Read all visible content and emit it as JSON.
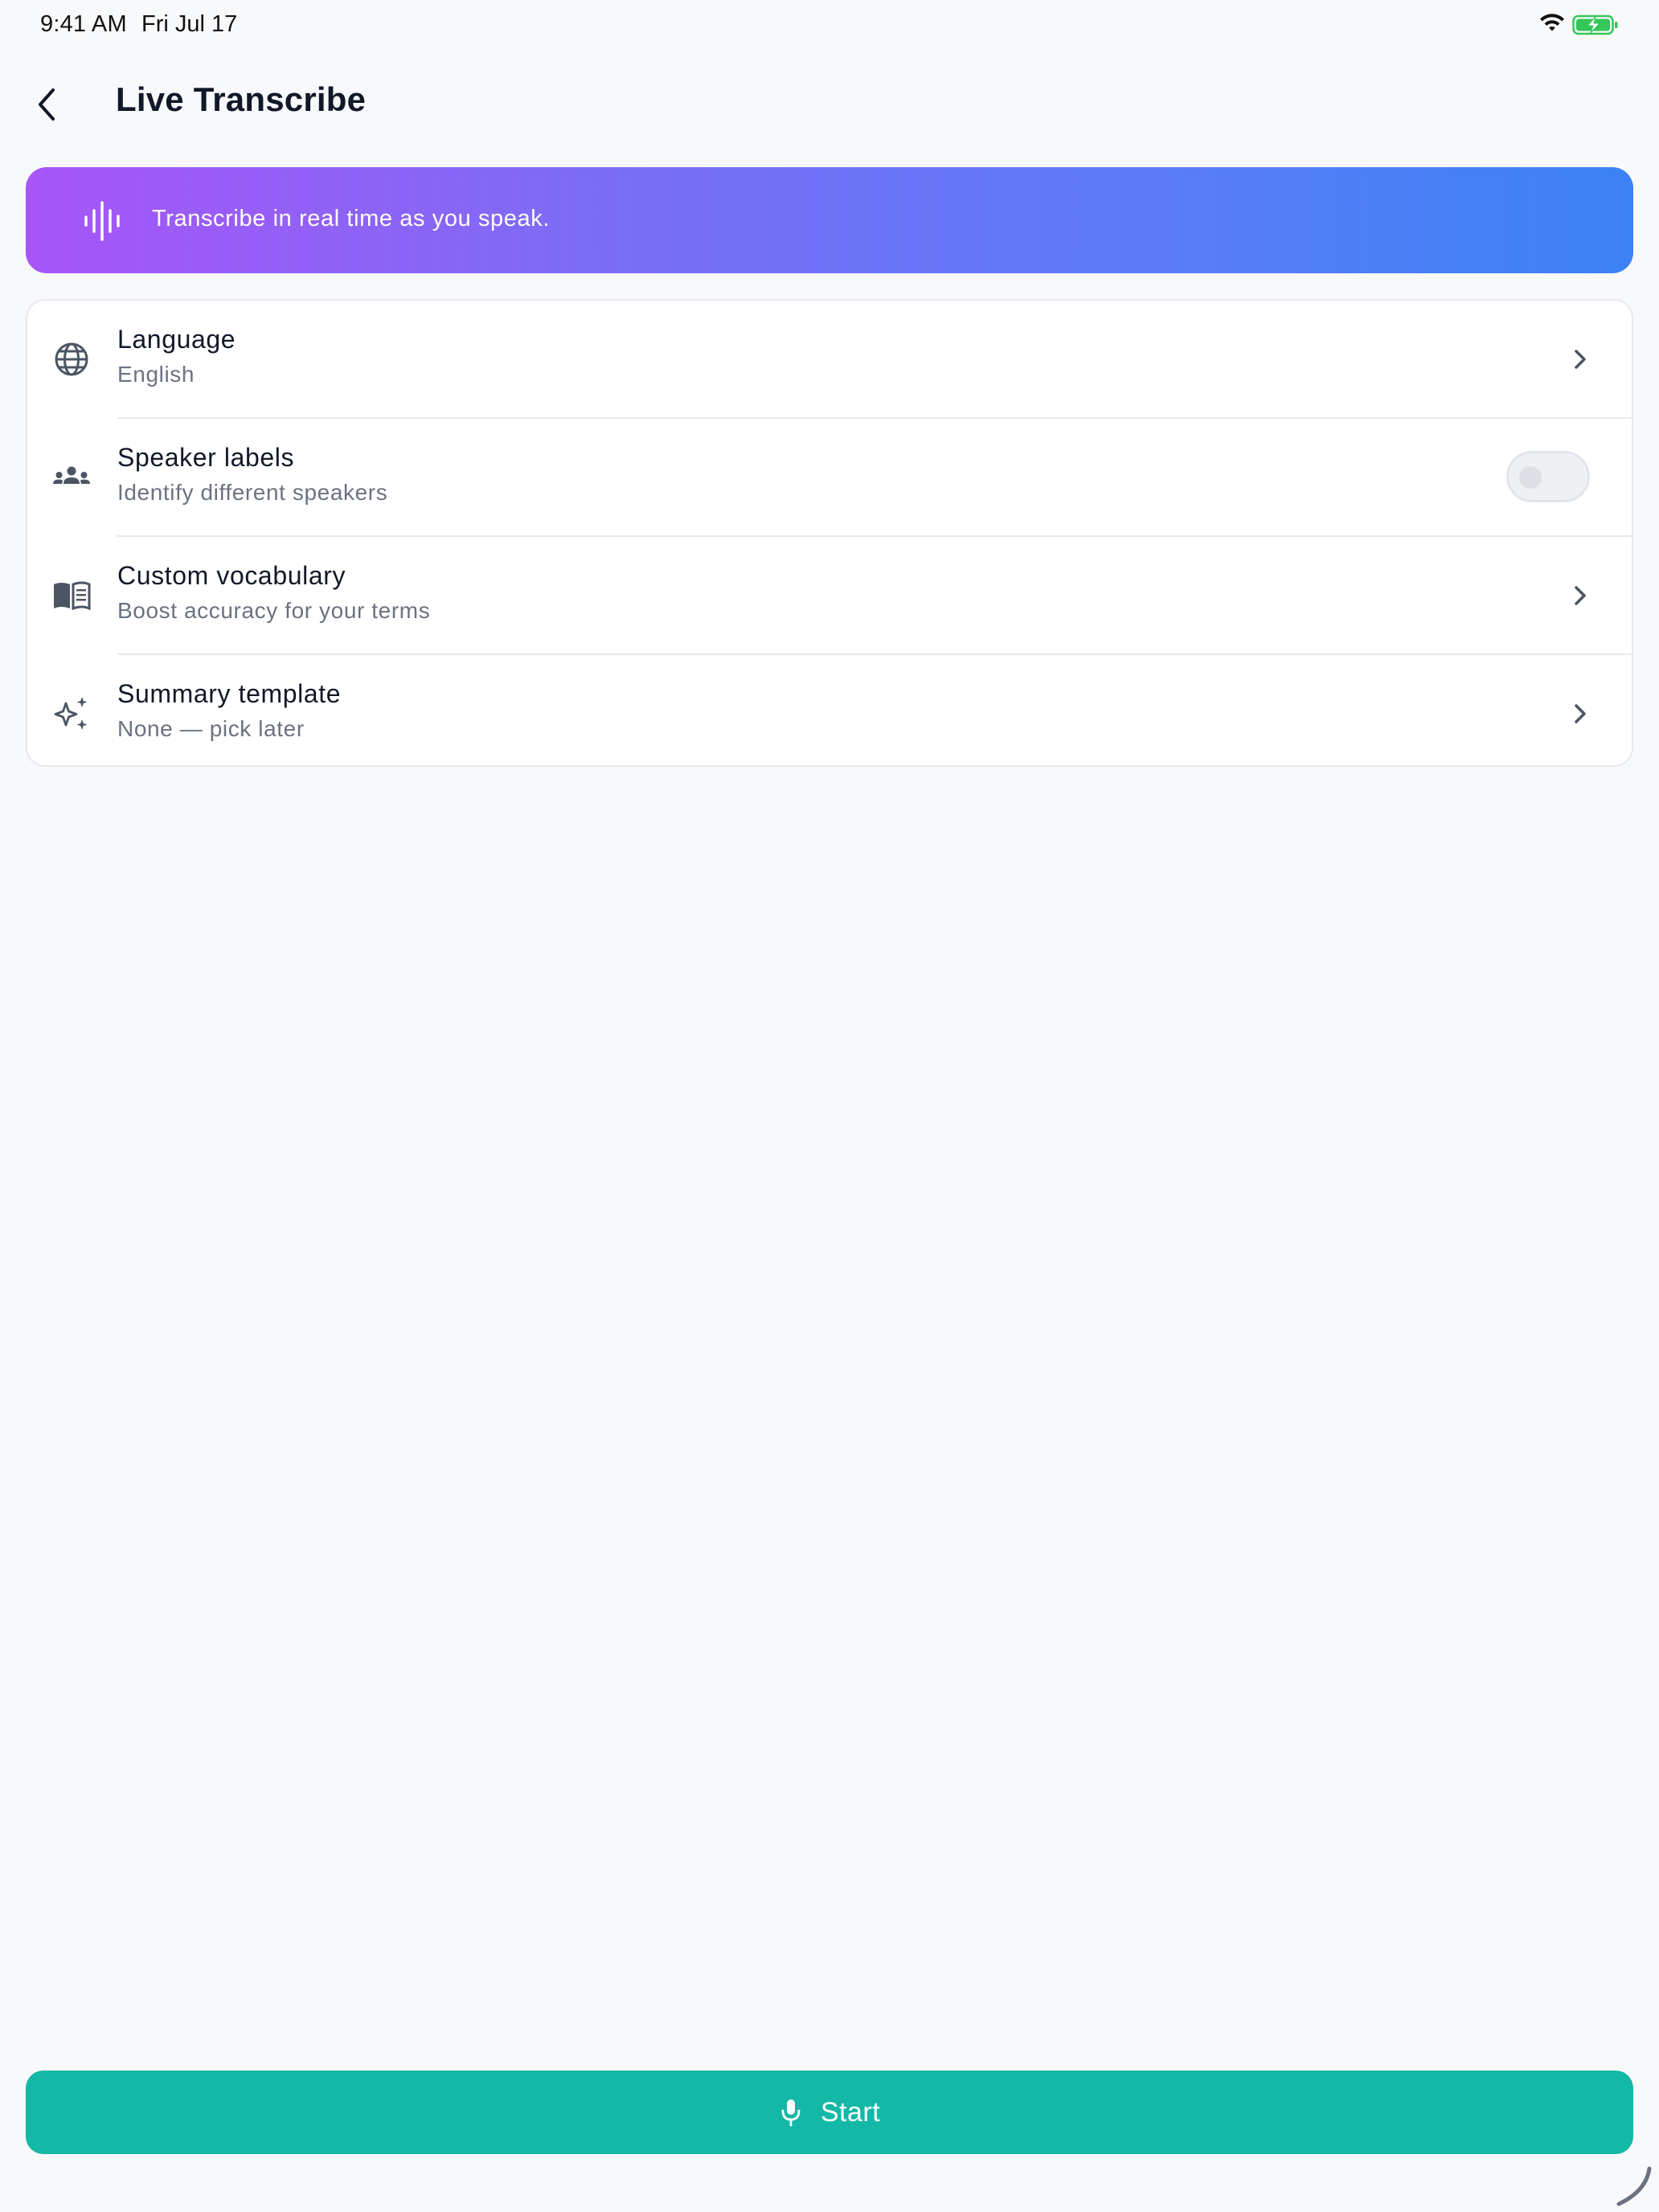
{
  "status_bar": {
    "time": "9:41 AM",
    "date": "Fri Jul 17",
    "icons": [
      "wifi-icon",
      "battery-charging-icon"
    ],
    "battery_color": "#34c759"
  },
  "header": {
    "back_icon": "chevron-left-icon",
    "title": "Live Transcribe"
  },
  "banner": {
    "icon": "audio-waveform-icon",
    "text": "Transcribe in real time as you speak.",
    "gradient_start": "#a855f7",
    "gradient_end": "#3b82f6"
  },
  "settings": [
    {
      "icon": "globe-icon",
      "title": "Language",
      "subtitle": "English",
      "control": "chevron"
    },
    {
      "icon": "people-icon",
      "title": "Speaker labels",
      "subtitle": "Identify different speakers",
      "control": "toggle",
      "toggle_on": false
    },
    {
      "icon": "book-icon",
      "title": "Custom vocabulary",
      "subtitle": "Boost accuracy for your terms",
      "control": "chevron"
    },
    {
      "icon": "sparkles-icon",
      "title": "Summary template",
      "subtitle": "None — pick later",
      "control": "chevron"
    }
  ],
  "start_button": {
    "icon": "microphone-icon",
    "label": "Start",
    "color": "#14b8a6"
  }
}
